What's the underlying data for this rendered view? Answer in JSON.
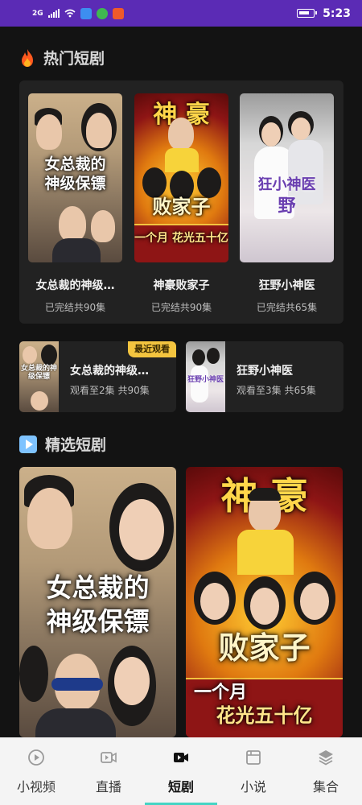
{
  "status_bar": {
    "network": "2G",
    "time": "5:23"
  },
  "hot_section": {
    "title": "热门短剧",
    "icon": "fire-icon",
    "items": [
      {
        "poster_title_line1": "女总裁的",
        "poster_title_line2": "神级保镖",
        "name": "女总裁的神级…",
        "meta": "已完结共90集"
      },
      {
        "poster_title_line1": "神  豪",
        "poster_title_line2": "败家子",
        "poster_sub": "一个月 花光五十亿",
        "name": "神豪败家子",
        "meta": "已完结共90集"
      },
      {
        "poster_title_line1": "狂小神医",
        "poster_title_line2": "野",
        "name": "狂野小神医",
        "meta": "已完结共65集"
      }
    ]
  },
  "recent_section": {
    "badge": "最近观看",
    "items": [
      {
        "thumb_title": "女总裁的神级保镖",
        "name": "女总裁的神级…",
        "meta": "观看至2集 共90集"
      },
      {
        "thumb_title": "狂野小神医",
        "name": "狂野小神医",
        "meta": "观看至3集 共65集"
      }
    ]
  },
  "featured_section": {
    "title": "精选短剧",
    "icon": "play-icon",
    "items": [
      {
        "poster_title_line1": "女总裁的",
        "poster_title_line2": "神级保镖"
      },
      {
        "poster_title_line1": "神    豪",
        "poster_title_line2": "败家子",
        "poster_sub1": "一个月",
        "poster_sub2": "花光五十亿"
      }
    ]
  },
  "bottom_nav": {
    "items": [
      {
        "label": "小视频",
        "icon": "play-circle-icon"
      },
      {
        "label": "直播",
        "icon": "live-camera-icon"
      },
      {
        "label": "短剧",
        "icon": "short-drama-icon",
        "active": true
      },
      {
        "label": "小说",
        "icon": "book-icon"
      },
      {
        "label": "集合",
        "icon": "layers-icon"
      }
    ]
  },
  "colors": {
    "status_bar": "#5b2bb5",
    "background": "#131313",
    "card": "#222222",
    "badge": "#f3c43f",
    "nav_active": "#44d4c4"
  }
}
